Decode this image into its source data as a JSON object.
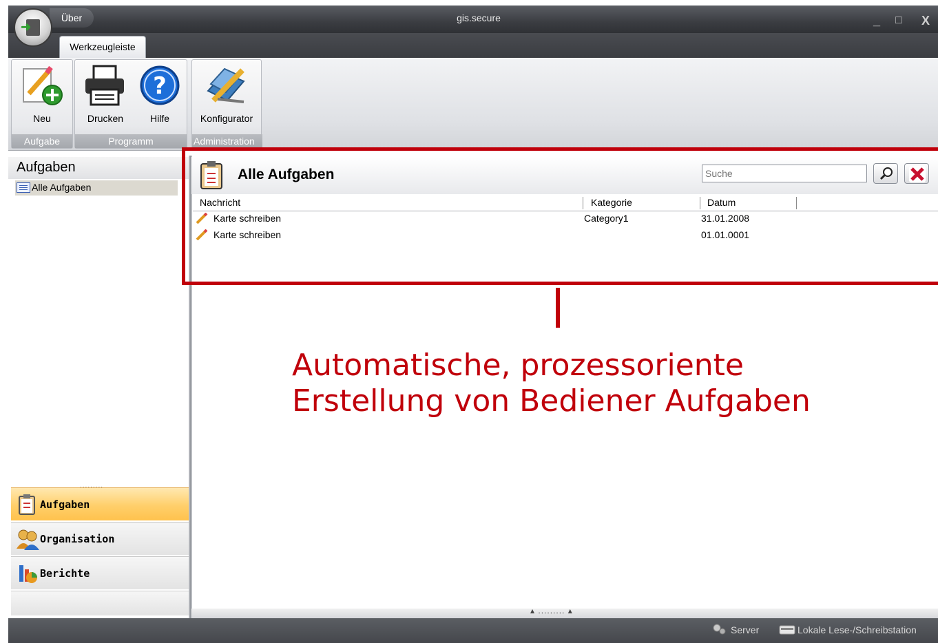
{
  "window": {
    "title": "gis.secure",
    "menu_label": "Über",
    "controls": [
      "_",
      "□",
      "X"
    ]
  },
  "ribbon": {
    "tab_label": "Werkzeugleiste",
    "groups": [
      {
        "label": "Aufgabe",
        "buttons": [
          {
            "label": "Neu",
            "icon": "new-task-icon"
          }
        ]
      },
      {
        "label": "Programm",
        "buttons": [
          {
            "label": "Drucken",
            "icon": "printer-icon"
          },
          {
            "label": "Hilfe",
            "icon": "help-icon"
          }
        ]
      },
      {
        "label": "Administration",
        "buttons": [
          {
            "label": "Konfigurator",
            "icon": "configurator-icon"
          }
        ]
      }
    ]
  },
  "sidebar": {
    "title": "Aufgaben",
    "tree_items": [
      {
        "label": "Alle Aufgaben",
        "icon": "list-icon"
      }
    ],
    "grip": ".........",
    "nav": [
      {
        "label": "Aufgaben",
        "icon": "clipboard-icon",
        "active": true
      },
      {
        "label": "Organisation",
        "icon": "people-icon",
        "active": false
      },
      {
        "label": "Berichte",
        "icon": "chart-icon",
        "active": false
      }
    ]
  },
  "main": {
    "title": "Alle Aufgaben",
    "search": {
      "placeholder": "Suche",
      "value": ""
    },
    "columns": [
      "Nachricht",
      "Kategorie",
      "Datum"
    ],
    "rows": [
      {
        "message": "Karte schreiben",
        "category": "Category1",
        "date": "31.01.2008"
      },
      {
        "message": "Karte schreiben",
        "category": "",
        "date": "01.01.0001"
      }
    ],
    "bottom_grip": "▴ ......... ▴"
  },
  "annotation": {
    "line1": "Automatische, prozessoriente",
    "line2": "Erstellung von Bediener Aufgaben",
    "color": "#c0000a"
  },
  "status": {
    "server": "Server",
    "reader": "Lokale Lese-/Schreibstation"
  }
}
